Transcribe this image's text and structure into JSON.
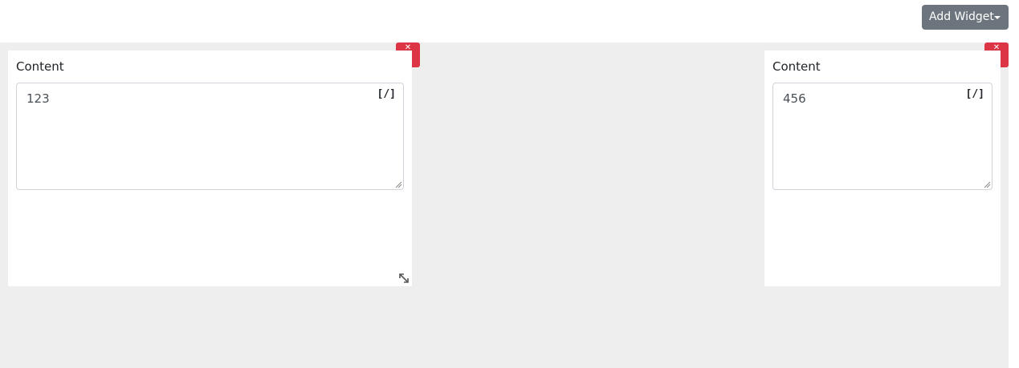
{
  "toolbar": {
    "add_widget_label": "Add Widget",
    "add_widget_color": "#6c757d"
  },
  "colors": {
    "canvas_bg": "#eeeeee",
    "remove_button": "#dc3545",
    "widget_bg": "#ffffff"
  },
  "widgets": [
    {
      "label": "Content",
      "value": "123",
      "code_toggle": "[/]",
      "icons": [
        "close-icon",
        "code-icon",
        "textarea-grip-icon",
        "resize-handle-icon"
      ]
    },
    {
      "label": "Content",
      "value": "456",
      "code_toggle": "[/]",
      "icons": [
        "close-icon",
        "code-icon",
        "textarea-grip-icon"
      ]
    }
  ]
}
